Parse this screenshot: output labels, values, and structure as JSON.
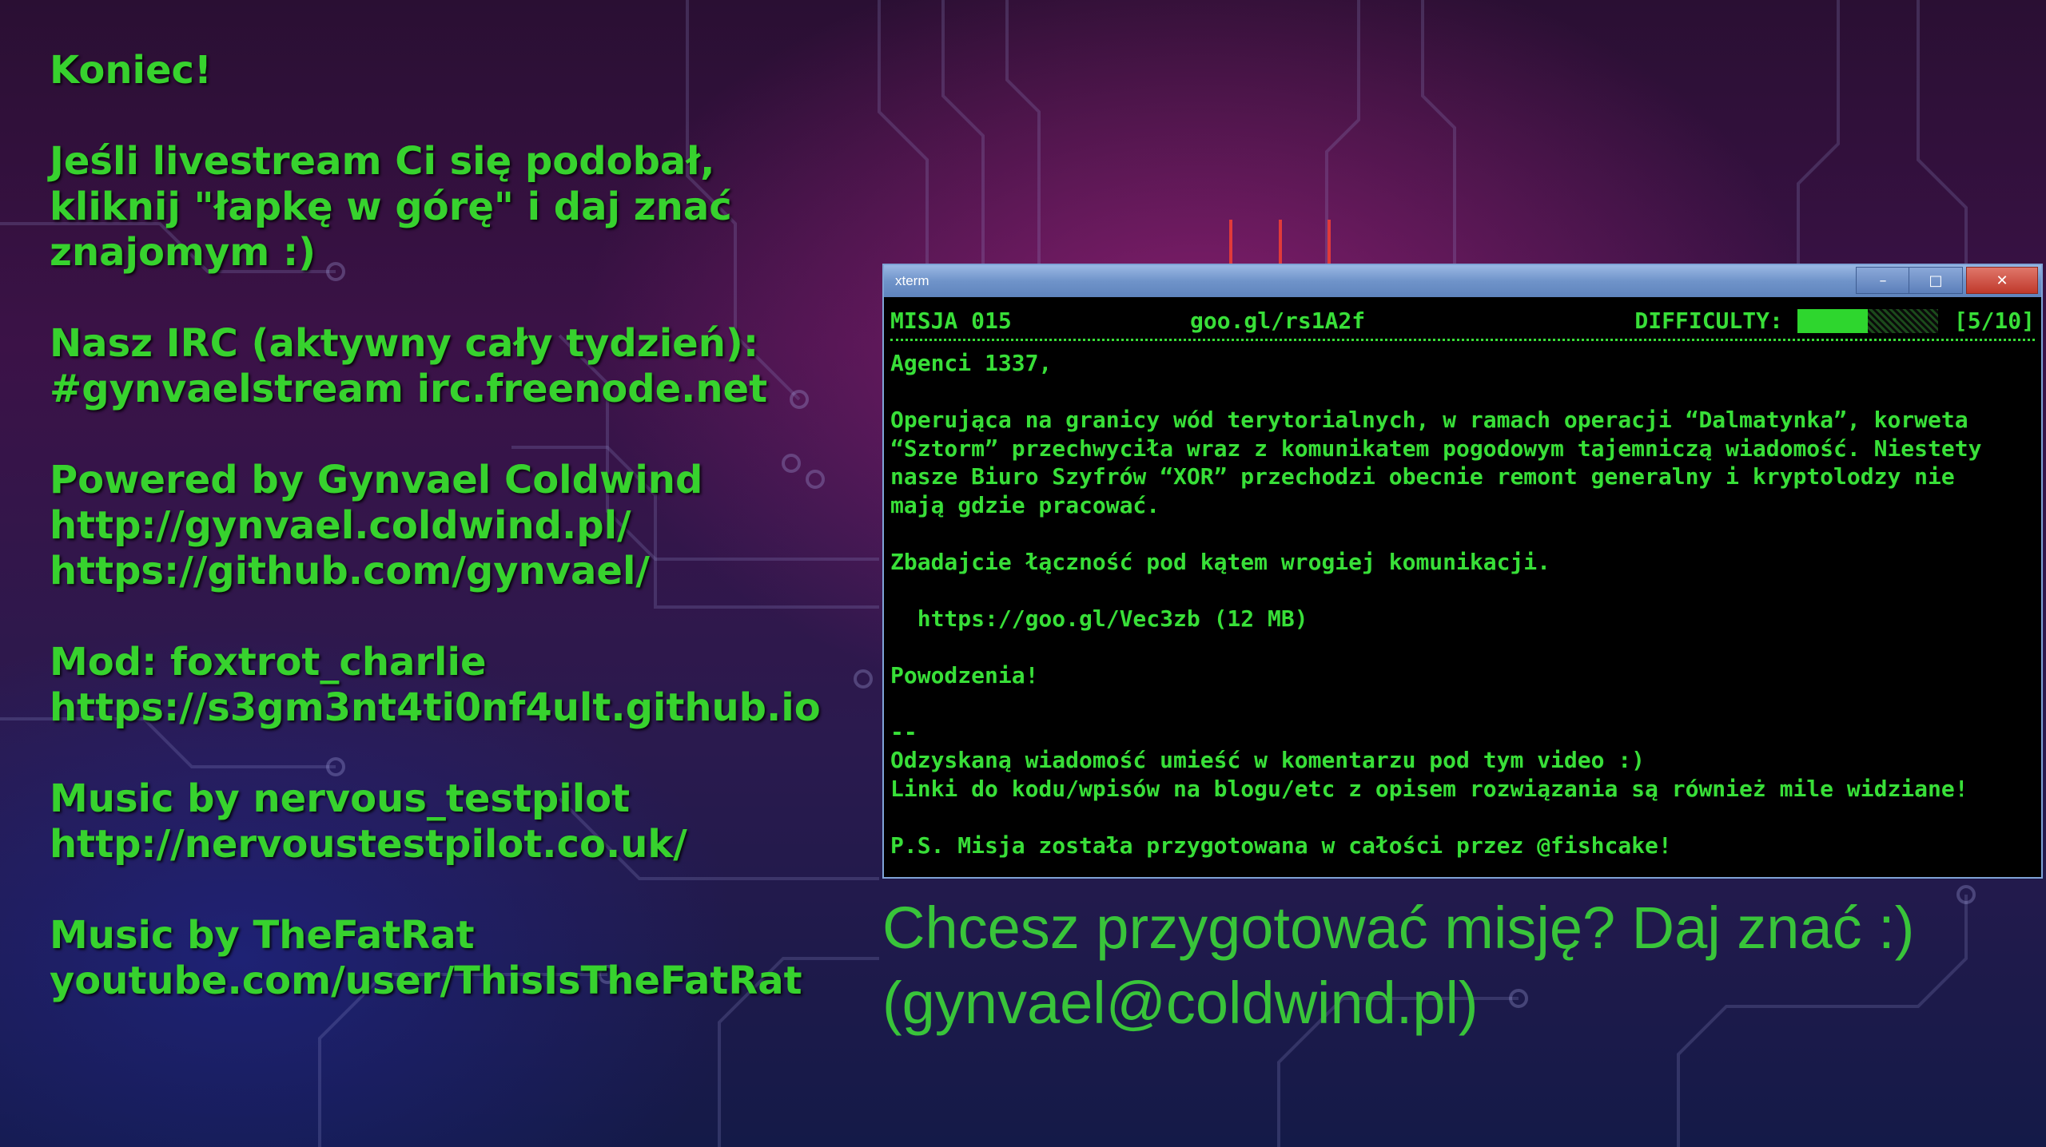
{
  "left_panel": {
    "lines": [
      "Koniec!",
      "",
      "Jeśli livestream Ci się podobał,",
      "kliknij \"łapkę w górę\" i daj znać",
      "znajomym :)",
      "",
      "Nasz IRC (aktywny cały tydzień):",
      "#gynvaelstream irc.freenode.net",
      "",
      "Powered by Gynvael Coldwind",
      "http://gynvael.coldwind.pl/",
      "https://github.com/gynvael/",
      "",
      "Mod: foxtrot_charlie",
      "https://s3gm3nt4ti0nf4ult.github.io",
      "",
      "Music by nervous_testpilot",
      "http://nervoustestpilot.co.uk/",
      "",
      "Music by TheFatRat",
      "youtube.com/user/ThisIsTheFatRat"
    ]
  },
  "xterm": {
    "window_title": "xterm",
    "buttons": {
      "minimize": "–",
      "maximize": "□",
      "close": "✕"
    },
    "header": {
      "mission": "MISJA 015",
      "link": "goo.gl/rs1A2f",
      "difficulty_label": "DIFFICULTY:",
      "difficulty_text": "[5/10]",
      "difficulty_value": 0.5
    },
    "body_lines": [
      "Agenci 1337,",
      "",
      "Operująca na granicy wód terytorialnych, w ramach operacji “Dalmatynka”, korweta",
      "“Sztorm” przechwyciła wraz z komunikatem pogodowym tajemniczą wiadomość. Niestety",
      "nasze Biuro Szyfrów “XOR” przechodzi obecnie remont generalny i kryptolodzy nie",
      "mają gdzie pracować.",
      "",
      "Zbadajcie łączność pod kątem wrogiej komunikacji.",
      "",
      "  https://goo.gl/Vec3zb (12 MB)",
      "",
      "Powodzenia!",
      "",
      "--",
      "Odzyskaną wiadomość umieść w komentarzu pod tym video :)",
      "Linki do kodu/wpisów na blogu/etc z opisem rozwiązania są również mile widziane!",
      "",
      "P.S. Misja została przygotowana w całości przez @fishcake!"
    ]
  },
  "promo": {
    "line1": "Chcesz przygotować misję? Daj znać :)",
    "line2": "(gynvael@coldwind.pl)"
  },
  "colors": {
    "text_green": "#37d22e",
    "terminal_green": "#38df38",
    "arrow_red": "#e03a3a"
  }
}
